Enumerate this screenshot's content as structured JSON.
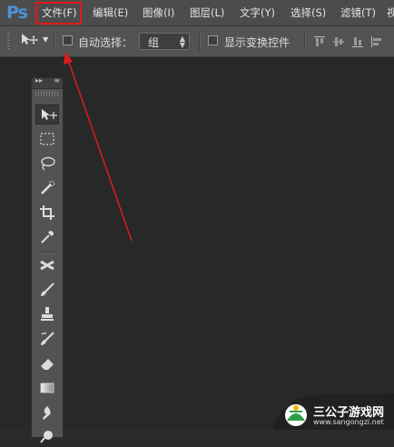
{
  "app": {
    "logo": "Ps"
  },
  "menu": {
    "items": [
      {
        "label": "文件(F)"
      },
      {
        "label": "编辑(E)"
      },
      {
        "label": "图像(I)"
      },
      {
        "label": "图层(L)"
      },
      {
        "label": "文字(Y)"
      },
      {
        "label": "选择(S)"
      },
      {
        "label": "滤镜(T)"
      },
      {
        "label": "视"
      }
    ]
  },
  "options_bar": {
    "auto_select_label": "自动选择：",
    "auto_select_checked": false,
    "auto_select_target": "组",
    "show_transform_label": "显示变换控件",
    "show_transform_checked": false
  },
  "tools_panel": {
    "tools": [
      {
        "name": "move-tool",
        "icon": "move-icon",
        "active": true
      },
      {
        "name": "marquee-tool",
        "icon": "rect-marquee-icon"
      },
      {
        "name": "lasso-tool",
        "icon": "lasso-icon"
      },
      {
        "name": "quick-select-tool",
        "icon": "quick-select-icon"
      },
      {
        "name": "crop-tool",
        "icon": "crop-icon"
      },
      {
        "name": "eyedropper-tool",
        "icon": "eyedropper-icon"
      },
      {
        "name": "healing-tool",
        "icon": "healing-icon"
      },
      {
        "name": "brush-tool",
        "icon": "brush-icon"
      },
      {
        "name": "stamp-tool",
        "icon": "stamp-icon"
      },
      {
        "name": "history-brush-tool",
        "icon": "history-brush-icon"
      },
      {
        "name": "eraser-tool",
        "icon": "eraser-icon"
      },
      {
        "name": "gradient-tool",
        "icon": "gradient-icon"
      },
      {
        "name": "blur-tool",
        "icon": "blur-icon"
      },
      {
        "name": "dodge-tool",
        "icon": "dodge-icon"
      }
    ]
  },
  "annotation": {
    "highlight_color": "#e01a1a"
  },
  "watermark": {
    "text": "三公子游戏网",
    "url": "www.sangongzi.net"
  }
}
